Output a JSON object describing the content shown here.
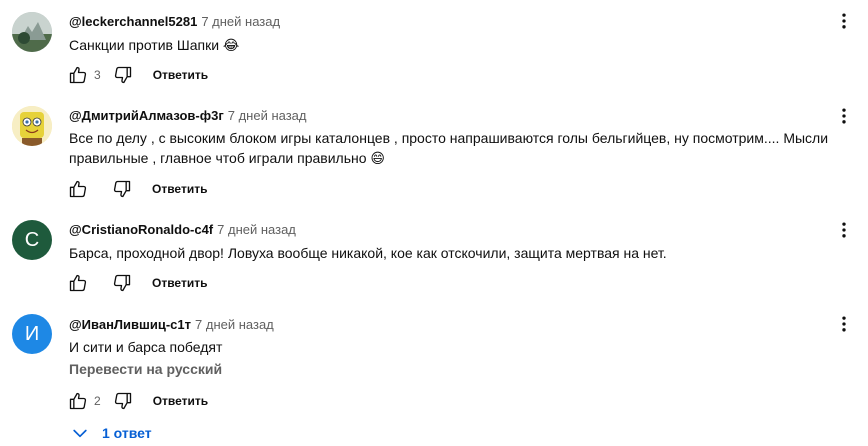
{
  "comments": [
    {
      "author": "@leckerchannel5281",
      "time": "7 дней назад",
      "text": "Санкции против Шапки 😂",
      "likes": "3",
      "reply_label": "Ответить",
      "avatar_color": "#7d8c86"
    },
    {
      "author": "@ДмитрийАлмазов-ф3г",
      "time": "7 дней назад",
      "text": "Все по делу , с высоким блоком игры каталонцев , просто напрашиваются голы бельгийцев, ну посмотрим.... Мысли правильные , главное чтоб играли правильно 😄",
      "likes": "",
      "reply_label": "Ответить",
      "avatar_color": "#e7d64a"
    },
    {
      "author": "@CristianoRonaldo-c4f",
      "time": "7 дней назад",
      "text": "Барса, проходной двор! Ловуха вообще никакой, кое как отскочили, защита мертвая на нет.",
      "likes": "",
      "reply_label": "Ответить",
      "avatar_letter": "C",
      "avatar_color": "#1e5a3c"
    },
    {
      "author": "@ИванЛившиц-с1т",
      "time": "7 дней назад",
      "text": "И сити и барса победят",
      "translate_label": "Перевести на русский",
      "likes": "2",
      "reply_label": "Ответить",
      "avatar_letter": "И",
      "avatar_color": "#1e88e5"
    }
  ],
  "replies_toggle": {
    "label": "1 ответ"
  },
  "icons": {
    "like": "thumb-up-icon",
    "dislike": "thumb-down-icon",
    "menu": "more-vert-icon",
    "expand": "chevron-down-icon"
  }
}
